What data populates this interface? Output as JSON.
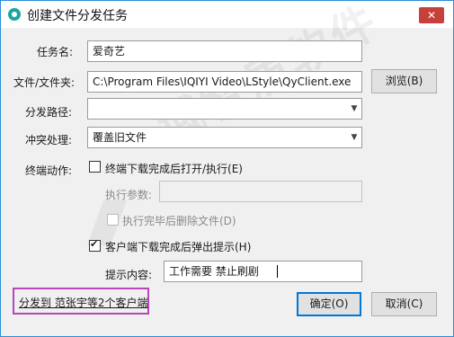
{
  "window": {
    "title": "创建文件分发任务",
    "close_glyph": "✕"
  },
  "form": {
    "task_name": {
      "label": "任务名:",
      "value": "爱奇艺"
    },
    "file": {
      "label": "文件/文件夹:",
      "value": "C:\\Program Files\\IQIYI Video\\LStyle\\QyClient.exe",
      "browse_label": "浏览(B)"
    },
    "dist_path": {
      "label": "分发路径:",
      "value": ""
    },
    "conflict": {
      "label": "冲突处理:",
      "value": "覆盖旧文件"
    },
    "terminal_action": {
      "label": "终端动作:",
      "open_after_download_label": "终端下载完成后打开/执行(E)",
      "open_after_download_checked": false
    },
    "exec_params": {
      "label": "执行参数:",
      "value": ""
    },
    "delete_after_exec": {
      "label": "执行完毕后删除文件(D)",
      "checked": false
    },
    "client_popup": {
      "label": "客户端下载完成后弹出提示(H)",
      "checked": true
    },
    "prompt_content": {
      "label": "提示内容:",
      "value": "工作需要 禁止刷剧"
    }
  },
  "footer": {
    "distribute_link": "分发到 范张宇等2个客户端",
    "ok_label": "确定(O)",
    "cancel_label": "取消(C)"
  },
  "watermark": {
    "text": "域智盾软件"
  },
  "icons": {
    "app": "app-logo-icon",
    "close": "close-icon",
    "dropdown": "chevron-down-icon",
    "check": "checkmark-icon"
  },
  "colors": {
    "window_border": "#2b8fd6",
    "close_button": "#c6413b",
    "highlight_box": "#b846b8",
    "default_button_border": "#0078d7"
  }
}
